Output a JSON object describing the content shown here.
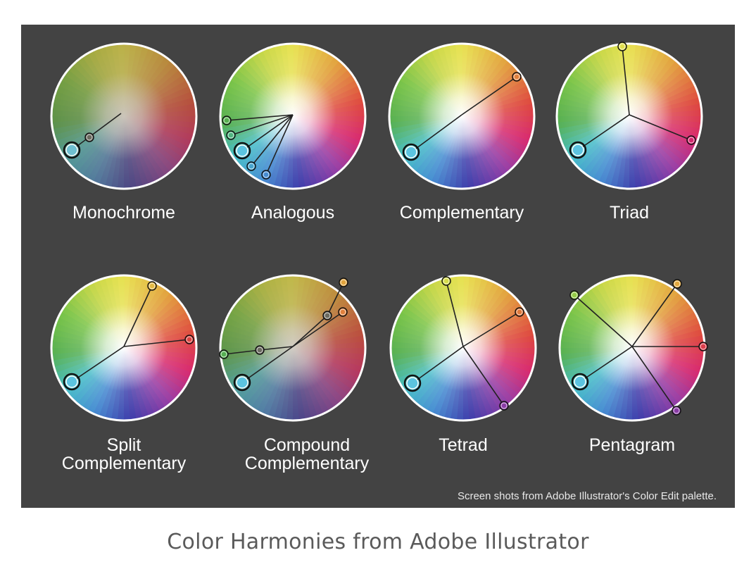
{
  "figure": {
    "background_color": "#434343",
    "note": "Screen shots from Adobe Illustrator's Color Edit palette."
  },
  "caption": "Color Harmonies from Adobe Illustrator",
  "harmonies": [
    {
      "label_lines": [
        "Monochrome"
      ]
    },
    {
      "label_lines": [
        "Analogous"
      ]
    },
    {
      "label_lines": [
        "Complementary"
      ]
    },
    {
      "label_lines": [
        "Triad"
      ]
    },
    {
      "label_lines": [
        "Split",
        "Complementary"
      ]
    },
    {
      "label_lines": [
        "Compound",
        "Complementary"
      ]
    },
    {
      "label_lines": [
        "Tetrad"
      ]
    },
    {
      "label_lines": [
        "Pentagram"
      ]
    }
  ]
}
